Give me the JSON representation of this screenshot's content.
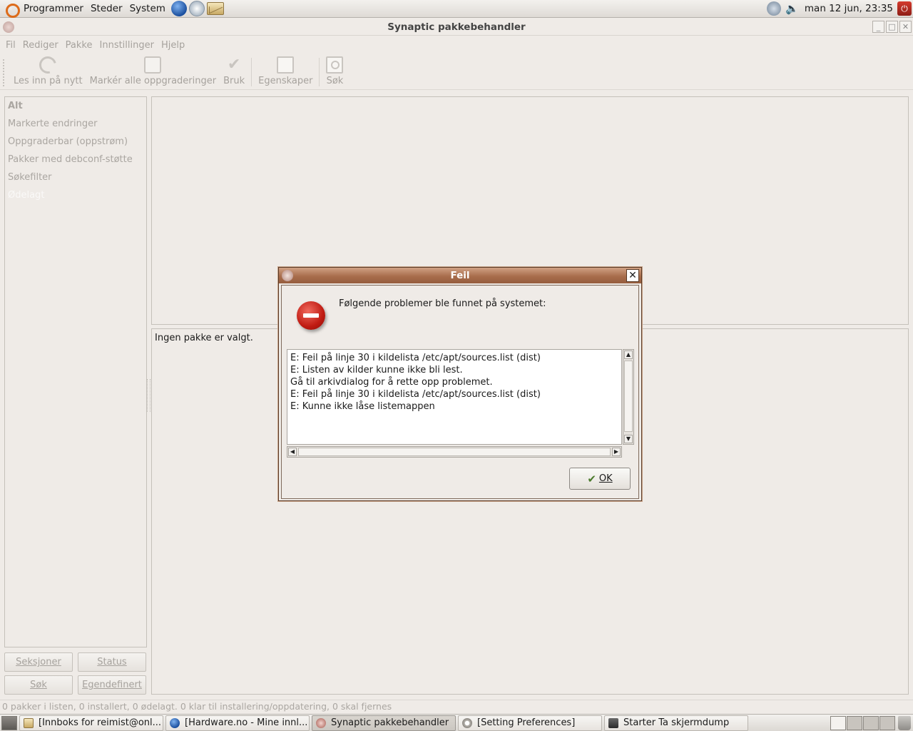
{
  "top_panel": {
    "menus": [
      "Programmer",
      "Steder",
      "System"
    ],
    "clock": "man 12 jun, 23:35"
  },
  "window": {
    "title": "Synaptic pakkebehandler",
    "menu": [
      "Fil",
      "Rediger",
      "Pakke",
      "Innstillinger",
      "Hjelp"
    ],
    "toolbar": {
      "reload": "Les inn på nytt",
      "mark_all": "Markér alle oppgraderinger",
      "apply": "Bruk",
      "properties": "Egenskaper",
      "search": "Søk"
    },
    "filters": [
      "Alt",
      "Markerte endringer",
      "Oppgraderbar (oppstrøm)",
      "Pakker med debconf-støtte",
      "Søkefilter",
      "Ødelagt"
    ],
    "left_buttons": {
      "sections": "Seksjoner",
      "status": "Status",
      "search": "Søk",
      "custom": "Egendefinert"
    },
    "info_text": "Ingen pakke er valgt.",
    "status_bar": "0 pakker i listen, 0 installert, 0 ødelagt. 0 klar til installering/oppdatering, 0 skal fjernes"
  },
  "dialog": {
    "title": "Feil",
    "message": "Følgende problemer ble funnet på systemet:",
    "details": [
      "E: Feil på linje 30 i kildelista /etc/apt/sources.list (dist)",
      "E: Listen av kilder kunne ikke bli lest.",
      "Gå til arkivdialog for å rette opp problemet.",
      "E: Feil på linje 30 i kildelista /etc/apt/sources.list (dist)",
      "E: Kunne ikke låse listemappen"
    ],
    "ok_label": "OK"
  },
  "taskbar": {
    "tasks": [
      "[Innboks for reimist@onl...",
      "[Hardware.no - Mine innl...",
      "Synaptic pakkebehandler",
      "[Setting Preferences]",
      "Starter Ta skjermdump"
    ]
  }
}
